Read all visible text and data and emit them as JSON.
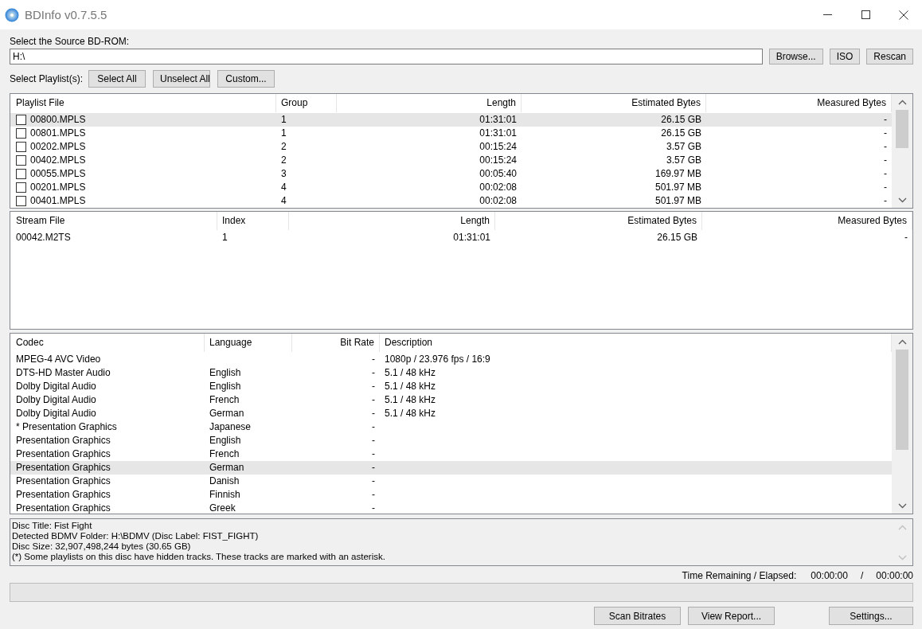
{
  "window": {
    "title": "BDInfo v0.7.5.5"
  },
  "source": {
    "label": "Select the Source BD-ROM:",
    "value": "H:\\",
    "buttons": [
      "Browse...",
      "ISO",
      "Rescan"
    ]
  },
  "playlist_selection": {
    "label": "Select Playlist(s):",
    "buttons": [
      "Select All",
      "Unselect All",
      "Custom..."
    ]
  },
  "playlists": {
    "columns": [
      {
        "label": "Playlist File"
      },
      {
        "label": "Group"
      },
      {
        "label": "Length"
      },
      {
        "label": "Estimated Bytes"
      },
      {
        "label": "Measured Bytes"
      }
    ],
    "rows": [
      {
        "cells": [
          "00800.MPLS",
          "1",
          "01:31:01",
          "26.15 GB",
          "-"
        ],
        "checked": false,
        "selected": true
      },
      {
        "cells": [
          "00801.MPLS",
          "1",
          "01:31:01",
          "26.15 GB",
          "-"
        ],
        "checked": false,
        "selected": false
      },
      {
        "cells": [
          "00202.MPLS",
          "2",
          "00:15:24",
          "3.57 GB",
          "-"
        ],
        "checked": false,
        "selected": false
      },
      {
        "cells": [
          "00402.MPLS",
          "2",
          "00:15:24",
          "3.57 GB",
          "-"
        ],
        "checked": false,
        "selected": false
      },
      {
        "cells": [
          "00055.MPLS",
          "3",
          "00:05:40",
          "169.97 MB",
          "-"
        ],
        "checked": false,
        "selected": false
      },
      {
        "cells": [
          "00201.MPLS",
          "4",
          "00:02:08",
          "501.97 MB",
          "-"
        ],
        "checked": false,
        "selected": false
      },
      {
        "cells": [
          "00401.MPLS",
          "4",
          "00:02:08",
          "501.97 MB",
          "-"
        ],
        "checked": false,
        "selected": false
      }
    ]
  },
  "stream_files": {
    "columns": [
      {
        "label": "Stream File"
      },
      {
        "label": "Index"
      },
      {
        "label": "Length"
      },
      {
        "label": "Estimated Bytes"
      },
      {
        "label": "Measured Bytes"
      }
    ],
    "rows": [
      {
        "cells": [
          "00042.M2TS",
          "1",
          "01:31:01",
          "26.15 GB",
          "-"
        ],
        "selected": false
      }
    ]
  },
  "streams": {
    "columns": [
      {
        "label": "Codec"
      },
      {
        "label": "Language"
      },
      {
        "label": "Bit Rate"
      },
      {
        "label": "Description"
      }
    ],
    "rows": [
      {
        "cells": [
          "MPEG-4 AVC Video",
          "",
          "-",
          "1080p / 23.976 fps / 16:9"
        ],
        "selected": false
      },
      {
        "cells": [
          "DTS-HD Master Audio",
          "English",
          "-",
          "5.1 / 48 kHz"
        ],
        "selected": false
      },
      {
        "cells": [
          "Dolby Digital Audio",
          "English",
          "-",
          "5.1 / 48 kHz"
        ],
        "selected": false
      },
      {
        "cells": [
          "Dolby Digital Audio",
          "French",
          "-",
          "5.1 / 48 kHz"
        ],
        "selected": false
      },
      {
        "cells": [
          "Dolby Digital Audio",
          "German",
          "-",
          "5.1 / 48 kHz"
        ],
        "selected": false
      },
      {
        "cells": [
          "* Presentation Graphics",
          "Japanese",
          "-",
          ""
        ],
        "selected": false
      },
      {
        "cells": [
          "Presentation Graphics",
          "English",
          "-",
          ""
        ],
        "selected": false
      },
      {
        "cells": [
          "Presentation Graphics",
          "French",
          "-",
          ""
        ],
        "selected": false
      },
      {
        "cells": [
          "Presentation Graphics",
          "German",
          "-",
          ""
        ],
        "selected": true
      },
      {
        "cells": [
          "Presentation Graphics",
          "Danish",
          "-",
          ""
        ],
        "selected": false
      },
      {
        "cells": [
          "Presentation Graphics",
          "Finnish",
          "-",
          ""
        ],
        "selected": false
      },
      {
        "cells": [
          "Presentation Graphics",
          "Greek",
          "-",
          ""
        ],
        "selected": false
      }
    ]
  },
  "disc_info": {
    "lines": [
      "Disc Title: Fist Fight",
      "Detected BDMV Folder: H:\\BDMV (Disc Label: FIST_FIGHT)",
      "Disc Size: 32,907,498,244 bytes (30.65 GB)",
      "(*) Some playlists on this disc have hidden tracks. These tracks are marked with an asterisk."
    ]
  },
  "time": {
    "label": "Time Remaining / Elapsed:",
    "remaining": "00:00:00",
    "separator": "/",
    "elapsed": "00:00:00"
  },
  "progress": {
    "level": 0
  },
  "buttons": [
    "Scan Bitrates",
    "View Report...",
    "Settings..."
  ]
}
